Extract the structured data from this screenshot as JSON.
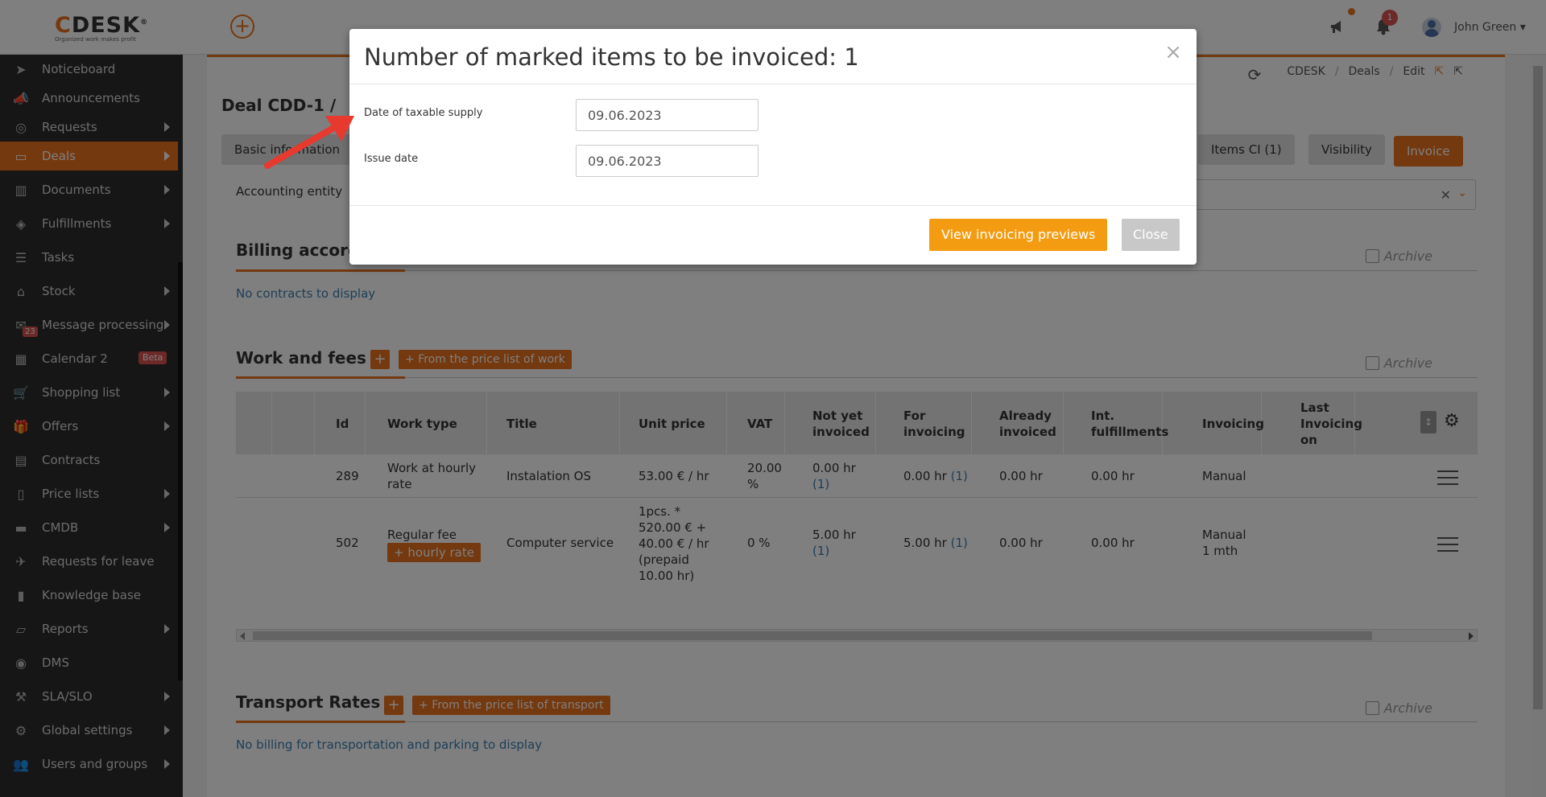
{
  "topbar": {
    "logo_c": "C",
    "logo_rest": "DESK",
    "logo_reg": "®",
    "logo_tagline": "Organized work makes profit",
    "notifications_count": "1",
    "user_name": "John Green"
  },
  "sidebar": {
    "items": [
      {
        "label": "Noticeboard",
        "icon": "paper-plane-icon"
      },
      {
        "label": "Announcements",
        "icon": "megaphone-icon"
      },
      {
        "label": "Requests",
        "icon": "lifebuoy-icon"
      },
      {
        "label": "Deals",
        "icon": "money-icon"
      },
      {
        "label": "Documents",
        "icon": "books-icon"
      },
      {
        "label": "Fulfillments",
        "icon": "box-icon"
      },
      {
        "label": "Tasks",
        "icon": "tasks-icon"
      },
      {
        "label": "Stock",
        "icon": "warehouse-icon"
      },
      {
        "label": "Message processing",
        "icon": "envelope-icon",
        "badge": "23"
      },
      {
        "label": "Calendar 2",
        "icon": "calendar-icon",
        "badge": "Beta"
      },
      {
        "label": "Shopping list",
        "icon": "cart-icon"
      },
      {
        "label": "Offers",
        "icon": "gift-icon"
      },
      {
        "label": "Contracts",
        "icon": "contract-icon"
      },
      {
        "label": "Price lists",
        "icon": "document-icon"
      },
      {
        "label": "CMDB",
        "icon": "folder-icon"
      },
      {
        "label": "Requests for leave",
        "icon": "plane-icon"
      },
      {
        "label": "Knowledge base",
        "icon": "book-icon"
      },
      {
        "label": "Reports",
        "icon": "folder-open-icon"
      },
      {
        "label": "DMS",
        "icon": "database-icon"
      },
      {
        "label": "SLA/SLO",
        "icon": "gavel-icon"
      },
      {
        "label": "Global settings",
        "icon": "gears-icon"
      },
      {
        "label": "Users and groups",
        "icon": "users-icon"
      }
    ]
  },
  "breadcrumb": [
    "CDESK",
    "Deals",
    "Edit"
  ],
  "deal_title": "Deal CDD-1 /",
  "tabs": {
    "basic": "Basic information",
    "items_ci": "Items CI (1)",
    "visibility": "Visibility",
    "invoice": "Invoice"
  },
  "accounting_entity_label": "Accounting entity",
  "billing": {
    "title": "Billing accord",
    "archive": "Archive",
    "empty": "No contracts to display"
  },
  "work": {
    "title": "Work and fees",
    "from_price_list": "From the price list of work",
    "archive": "Archive",
    "columns": [
      "Id",
      "Work type",
      "Title",
      "Unit price",
      "VAT",
      "Not yet invoiced",
      "For invoicing",
      "Already invoiced",
      "Int. fulfillments",
      "Invoicing",
      "Last Invoicing on"
    ],
    "rows": [
      {
        "id": "289",
        "work_type": "Work at hourly rate",
        "title": "Instalation OS",
        "unit_price": "53.00 € / hr",
        "vat": "20.00 %",
        "not_yet": "0.00 hr",
        "not_yet_link": "(1)",
        "for_inv": "0.00 hr",
        "for_inv_link": "(1)",
        "already": "0.00 hr",
        "int": "0.00 hr",
        "invoicing": "Manual",
        "last": ""
      },
      {
        "id": "502",
        "work_type": "Regular fee",
        "work_type_tag": "hourly rate",
        "title": "Computer service",
        "unit_price": "1pcs. * 520.00 € + 40.00 € / hr (prepaid 10.00 hr)",
        "vat": "0 %",
        "not_yet": "5.00 hr",
        "not_yet_link": "(1)",
        "for_inv": "5.00 hr",
        "for_inv_link": "(1)",
        "already": "0.00 hr",
        "int": "0.00 hr",
        "invoicing": "Manual",
        "invoicing2": "1 mth",
        "last": ""
      }
    ]
  },
  "transport": {
    "title": "Transport Rates",
    "from_price_list": "From the price list of transport",
    "archive": "Archive",
    "empty": "No billing for transportation and parking to display"
  },
  "modal": {
    "title": "Number of marked items to be invoiced: 1",
    "taxable_label": "Date of taxable supply",
    "taxable_value": "09.06.2023",
    "issue_label": "Issue date",
    "issue_value": "09.06.2023",
    "preview_btn": "View invoicing previews",
    "close_btn": "Close"
  },
  "colors": {
    "accent": "#e8731e",
    "button_preview": "#f39c12",
    "annotation_arrow": "#e8392f"
  }
}
